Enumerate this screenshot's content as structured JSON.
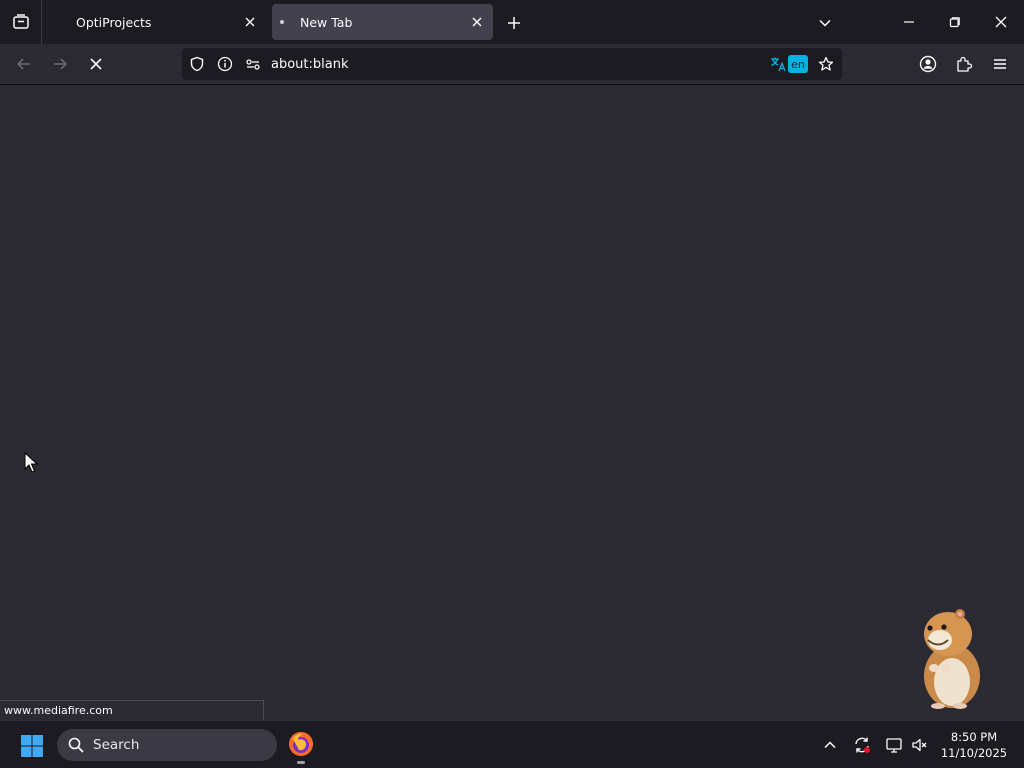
{
  "tabs": [
    {
      "label": "OptiProjects",
      "active": false
    },
    {
      "label": "New Tab",
      "active": true,
      "loading": true
    }
  ],
  "navbar": {
    "url": "about:blank",
    "translate_lang": "en"
  },
  "status": {
    "hover_link": "www.mediafire.com"
  },
  "taskbar": {
    "search_label": "Search",
    "clock_time": "8:50 PM",
    "clock_date": "11/10/2025"
  },
  "colors": {
    "tab_bg": "#1c1b22",
    "active_tab": "#42414d",
    "content_bg": "#2b2a33",
    "translate_accent": "#00b3e3"
  },
  "icons": [
    "tab-list-icon",
    "close-icon",
    "plus-icon",
    "chevron-down-icon",
    "minimize-icon",
    "restore-icon",
    "window-close-icon",
    "back-arrow-icon",
    "forward-arrow-icon",
    "stop-icon",
    "shield-icon",
    "info-icon",
    "permissions-icon",
    "translate-icon",
    "bookmark-star-icon",
    "account-icon",
    "extensions-icon",
    "menu-icon",
    "windows-logo-icon",
    "search-icon",
    "firefox-icon",
    "chevron-up-icon",
    "sync-icon",
    "display-icon",
    "volume-muted-icon"
  ]
}
